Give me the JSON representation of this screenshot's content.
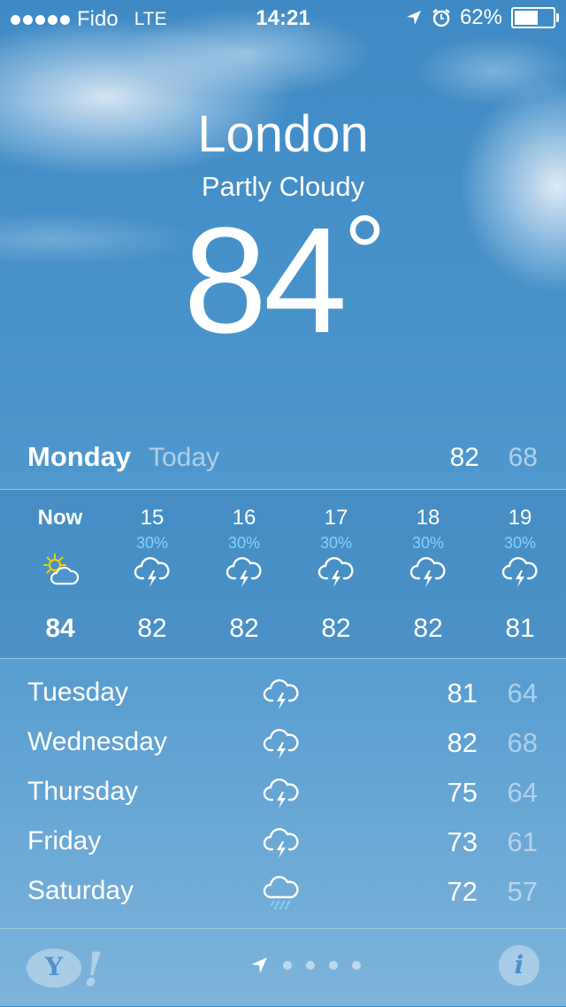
{
  "status_bar": {
    "carrier": "Fido",
    "network": "LTE",
    "time": "14:21",
    "battery": "62%",
    "battery_level": 0.62,
    "icons": [
      "signal-dots",
      "location-arrow-icon",
      "alarm-icon",
      "battery-icon"
    ]
  },
  "location": {
    "city": "London",
    "condition": "Partly Cloudy",
    "temperature": "84",
    "degree_symbol": "°"
  },
  "today": {
    "day": "Monday",
    "label": "Today",
    "high": "82",
    "low": "68"
  },
  "hourly": [
    {
      "label": "Now",
      "pop": "",
      "icon": "partly-sunny-icon",
      "temp": "84"
    },
    {
      "label": "15",
      "pop": "30%",
      "icon": "thunderstorm-icon",
      "temp": "82"
    },
    {
      "label": "16",
      "pop": "30%",
      "icon": "thunderstorm-icon",
      "temp": "82"
    },
    {
      "label": "17",
      "pop": "30%",
      "icon": "thunderstorm-icon",
      "temp": "82"
    },
    {
      "label": "18",
      "pop": "30%",
      "icon": "thunderstorm-icon",
      "temp": "82"
    },
    {
      "label": "19",
      "pop": "30%",
      "icon": "thunderstorm-icon",
      "temp": "81"
    }
  ],
  "daily": [
    {
      "day": "Tuesday",
      "icon": "thunderstorm-icon",
      "high": "81",
      "low": "64"
    },
    {
      "day": "Wednesday",
      "icon": "thunderstorm-icon",
      "high": "82",
      "low": "68"
    },
    {
      "day": "Thursday",
      "icon": "thunderstorm-icon",
      "high": "75",
      "low": "64"
    },
    {
      "day": "Friday",
      "icon": "thunderstorm-icon",
      "high": "73",
      "low": "61"
    },
    {
      "day": "Saturday",
      "icon": "rain-icon",
      "high": "72",
      "low": "57"
    }
  ],
  "footer": {
    "yahoo_logo": "Y!",
    "info_glyph": "i",
    "page_count": 4
  },
  "colors": {
    "sky_top": "#3f8ac5",
    "sky_bottom": "#7fb4da",
    "precip": "#7fd4ff",
    "sun": "#f5d000"
  }
}
